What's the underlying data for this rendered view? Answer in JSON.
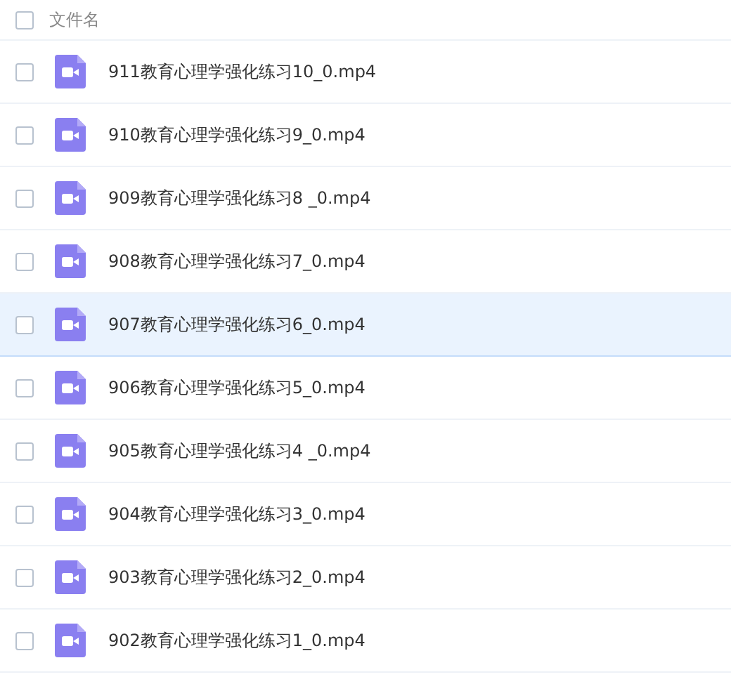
{
  "header": {
    "checked": false,
    "label": "文件名"
  },
  "files": [
    {
      "name": "911教育心理学强化练习10_0.mp4",
      "checked": false,
      "hovered": false
    },
    {
      "name": "910教育心理学强化练习9_0.mp4",
      "checked": false,
      "hovered": false
    },
    {
      "name": "909教育心理学强化练习8 _0.mp4",
      "checked": false,
      "hovered": false
    },
    {
      "name": "908教育心理学强化练习7_0.mp4",
      "checked": false,
      "hovered": false
    },
    {
      "name": "907教育心理学强化练习6_0.mp4",
      "checked": false,
      "hovered": true
    },
    {
      "name": "906教育心理学强化练习5_0.mp4",
      "checked": false,
      "hovered": false
    },
    {
      "name": "905教育心理学强化练习4 _0.mp4",
      "checked": false,
      "hovered": false
    },
    {
      "name": "904教育心理学强化练习3_0.mp4",
      "checked": false,
      "hovered": false
    },
    {
      "name": "903教育心理学强化练习2_0.mp4",
      "checked": false,
      "hovered": false
    },
    {
      "name": "902教育心理学强化练习1_0.mp4",
      "checked": false,
      "hovered": false
    }
  ]
}
